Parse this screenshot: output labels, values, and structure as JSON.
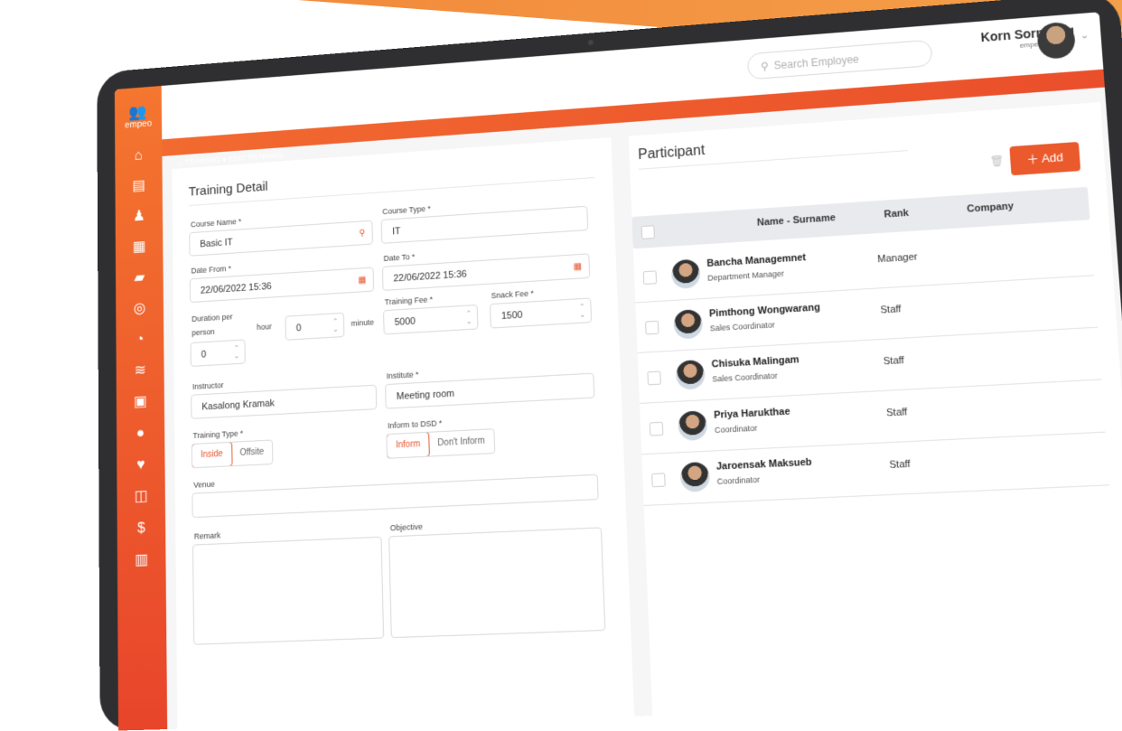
{
  "header": {
    "search_placeholder": "Search Employee",
    "user_name": "Korn Sornkeng",
    "user_company": "empeo Academy"
  },
  "sidebar": {
    "logo_text": "empeo",
    "icons": [
      "home-icon",
      "document-icon",
      "person-icon",
      "calendar-icon",
      "wallet-icon",
      "target-icon",
      "gauge-icon",
      "coins-icon",
      "report-icon",
      "chat-icon",
      "heart-hand-icon",
      "training-icon",
      "money-bag-icon",
      "chart-icon"
    ]
  },
  "breadcrumb": {
    "root": "TRAINING",
    "current": "EDIT TRAINING"
  },
  "training_detail": {
    "title": "Training Detail",
    "course_name_label": "Course Name *",
    "course_name_value": "Basic IT",
    "course_type_label": "Course Type *",
    "course_type_value": "IT",
    "date_from_label": "Date From *",
    "date_from_value": "22/06/2022 15:36",
    "date_to_label": "Date To *",
    "date_to_value": "22/06/2022 15:36",
    "duration_label_1": "Duration per",
    "duration_label_2": "person",
    "hour_label": "hour",
    "hour_value": "0",
    "minute_label": "minute",
    "minute_value": "0",
    "training_fee_label": "Training Fee *",
    "training_fee_value": "5000",
    "snack_fee_label": "Snack Fee *",
    "snack_fee_value": "1500",
    "instructor_label": "Instructor",
    "instructor_value": "Kasalong  Kramak",
    "institute_label": "Institute *",
    "institute_value": "Meeting room",
    "training_type_label": "Training Type *",
    "training_type_options": [
      "Inside",
      "Offsite"
    ],
    "training_type_selected": "Inside",
    "inform_label": "Inform to DSD *",
    "inform_options": [
      "Inform",
      "Don't Inform"
    ],
    "inform_selected": "Inform",
    "venue_label": "Venue",
    "remark_label": "Remark",
    "objective_label": "Objective"
  },
  "participant": {
    "title": "Participant",
    "add_label": "Add",
    "columns": [
      "Name - Surname",
      "Rank",
      "Company"
    ],
    "rows": [
      {
        "name": "Bancha Managemnet",
        "position": "Department Manager",
        "rank": "Manager"
      },
      {
        "name": "Pimthong Wongwarang",
        "position": "Sales Coordinator",
        "rank": "Staff"
      },
      {
        "name": "Chisuka Malingam",
        "position": "Sales Coordinator",
        "rank": "Staff"
      },
      {
        "name": "Priya Harukthae",
        "position": "Coordinator",
        "rank": "Staff"
      },
      {
        "name": "Jaroensak Maksueb",
        "position": "Coordinator",
        "rank": "Staff"
      }
    ]
  }
}
